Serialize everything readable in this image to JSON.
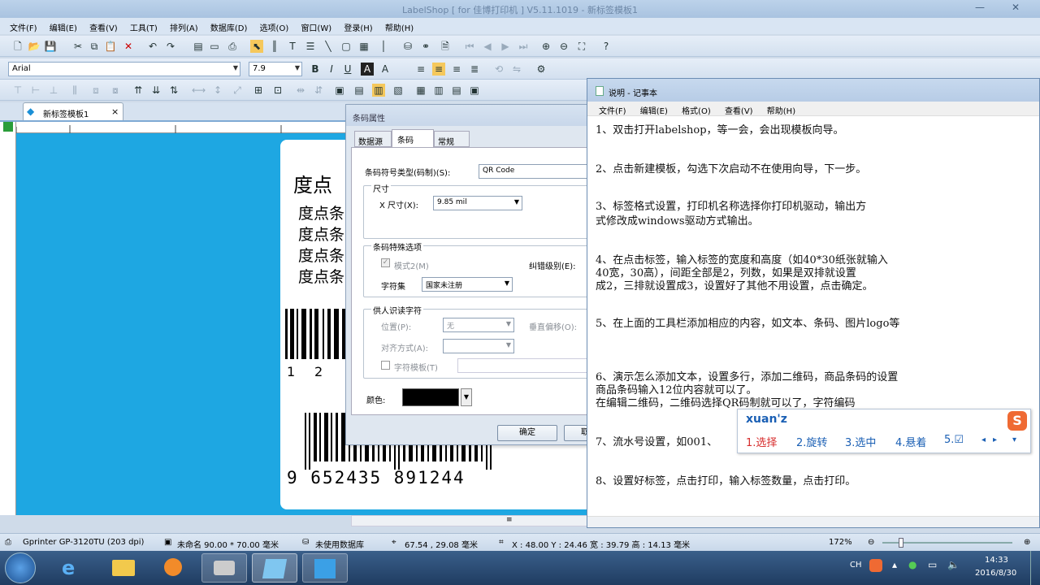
{
  "app": {
    "title": "LabelShop [ for 佳博打印机 ] V5.11.1019 - 新标签模板1",
    "menu": [
      "文件(F)",
      "编辑(E)",
      "查看(V)",
      "工具(T)",
      "排列(A)",
      "数据库(D)",
      "选项(O)",
      "窗口(W)",
      "登录(H)",
      "帮助(H)"
    ],
    "font_name": "Arial",
    "font_size": "7.9",
    "doc_tab": "新标签模板1",
    "close_tab": "×"
  },
  "label": {
    "heading": "度点",
    "lines": [
      "度点条",
      "度点条",
      "度点条",
      "度点条"
    ],
    "barcode_digits_partial": [
      "1",
      "2"
    ],
    "ean_digits": "9 652435 891244"
  },
  "dialog": {
    "title": "条码属性",
    "tabs": [
      "数据源",
      "条码",
      "常规"
    ],
    "type_label": "条码符号类型(码制)(S):",
    "type_value": "QR Code",
    "size_group": "尺寸",
    "size_label": "X 尺寸(X):",
    "size_value": "9.85 mil",
    "special_group": "条码特殊选项",
    "mode_label": "模式2(M)",
    "ecc_label": "纠错级别(E):",
    "charset_label": "字符集",
    "charset_value": "国家未注册",
    "hri_group": "供人识读字符",
    "position_label": "位置(P):",
    "position_value": "无",
    "vertical_offset": "垂直偏移(O):",
    "align_label": "对齐方式(A):",
    "font_template": "字符模板(T)",
    "color_label": "颜色:",
    "ok": "确定",
    "cancel": "取"
  },
  "notepad": {
    "title": "说明 - 记事本",
    "menu": [
      "文件(F)",
      "编辑(E)",
      "格式(O)",
      "查看(V)",
      "帮助(H)"
    ],
    "lines": [
      "1、双击打开labelshop，等一会，会出现模板向导。",
      "2、点击新建模板，勾选下次启动不在使用向导，下一步。",
      "3、标签格式设置，打印机名称选择你打印机驱动，输出方",
      "   式修改成windows驱动方式输出。",
      "4、在点击标签，输入标签的宽度和高度（如40*30纸张就输入",
      "   40宽，30高），间距全部是2，列数，如果是双排就设置",
      "   成2，三排就设置成3，设置好了其他不用设置，点击确定。",
      "5、在上面的工具栏添加相应的内容，如文本、条码、图片logo等",
      "6、演示怎么添加文本，设置多行，添加二维码，商品条码的设置",
      "   商品条码输入12位内容就可以了。",
      "在编辑二维码，二维码选择QR码制就可以了，字符编码",
      "7、流水号设置，如001、",
      "8、设置好标签，点击打印，输入标签数量，点击打印。"
    ]
  },
  "ime": {
    "input": "xuan'z",
    "candidates": [
      "1.选择",
      "2.旋转",
      "3.选中",
      "4.悬着",
      "5.☑"
    ],
    "logo": "S"
  },
  "status": {
    "printer": "Gprinter GP-3120TU (203 dpi)",
    "size": "未命名 90.00 * 70.00 毫米",
    "db": "未使用数据库",
    "coords": "67.54 , 29.08 毫米",
    "xy": "X : 48.00 Y : 24.46 宽 : 39.79 高 : 14.13 毫米",
    "zoom": "172%"
  },
  "taskbar": {
    "time": "14:33",
    "date": "2016/8/30",
    "lang": "CH"
  }
}
